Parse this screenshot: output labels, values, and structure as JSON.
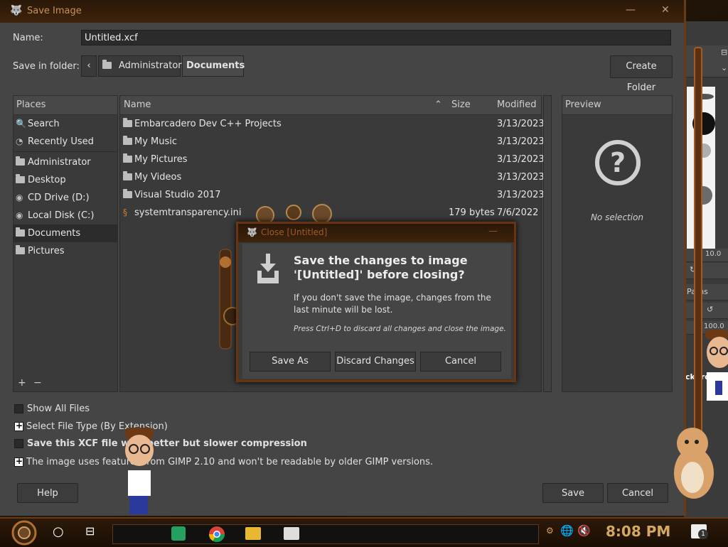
{
  "window": {
    "title": "Save Image"
  },
  "name_label": "Name:",
  "name_value": "Untitled.xcf",
  "folder_label": "Save in folder:",
  "breadcrumbs": [
    "Administrator",
    "Documents"
  ],
  "create_folder": "Create Folder",
  "places": {
    "header": "Places",
    "items": [
      "Search",
      "Recently Used",
      "Administrator",
      "Desktop",
      "CD Drive (D:)",
      "Local Disk (C:)",
      "Documents",
      "Pictures"
    ],
    "selected": "Documents"
  },
  "files": {
    "columns": {
      "name": "Name",
      "size": "Size",
      "modified": "Modified"
    },
    "rows": [
      {
        "name": "Embarcadero Dev C++ Projects",
        "size": "",
        "modified": "3/13/2023"
      },
      {
        "name": "My Music",
        "size": "",
        "modified": "3/13/2023"
      },
      {
        "name": "My Pictures",
        "size": "",
        "modified": "3/13/2023"
      },
      {
        "name": "My Videos",
        "size": "",
        "modified": "3/13/2023"
      },
      {
        "name": "Visual Studio 2017",
        "size": "",
        "modified": "3/13/2023"
      },
      {
        "name": "systemtransparency.ini",
        "size": "179 bytes",
        "modified": "7/6/2022"
      }
    ]
  },
  "preview": {
    "header": "Preview",
    "empty": "No selection"
  },
  "options": {
    "show_all": "Show All Files",
    "select_type": "Select File Type (By Extension)",
    "compression": "Save this XCF file with better but slower compression",
    "warning": "The image uses features from GIMP 2.10 and won't be readable by older GIMP versions."
  },
  "buttons": {
    "help": "Help",
    "save": "Save",
    "cancel": "Cancel"
  },
  "dialog": {
    "title": "Close [Untitled]",
    "heading": "Save the changes to image '[Untitled]' before closing?",
    "message": "If you don't save the image, changes from the last minute will be lost.",
    "hint": "Press Ctrl+D to discard all changes and close the image.",
    "save_as": "Save As",
    "discard": "Discard Changes",
    "cancel": "Cancel"
  },
  "right_panel": {
    "spin1": "10.0",
    "tab": "Paths",
    "spin2": "100.0",
    "partial": "ckgrou"
  },
  "taskbar": {
    "time": "8:08 PM",
    "notifications": "1"
  }
}
